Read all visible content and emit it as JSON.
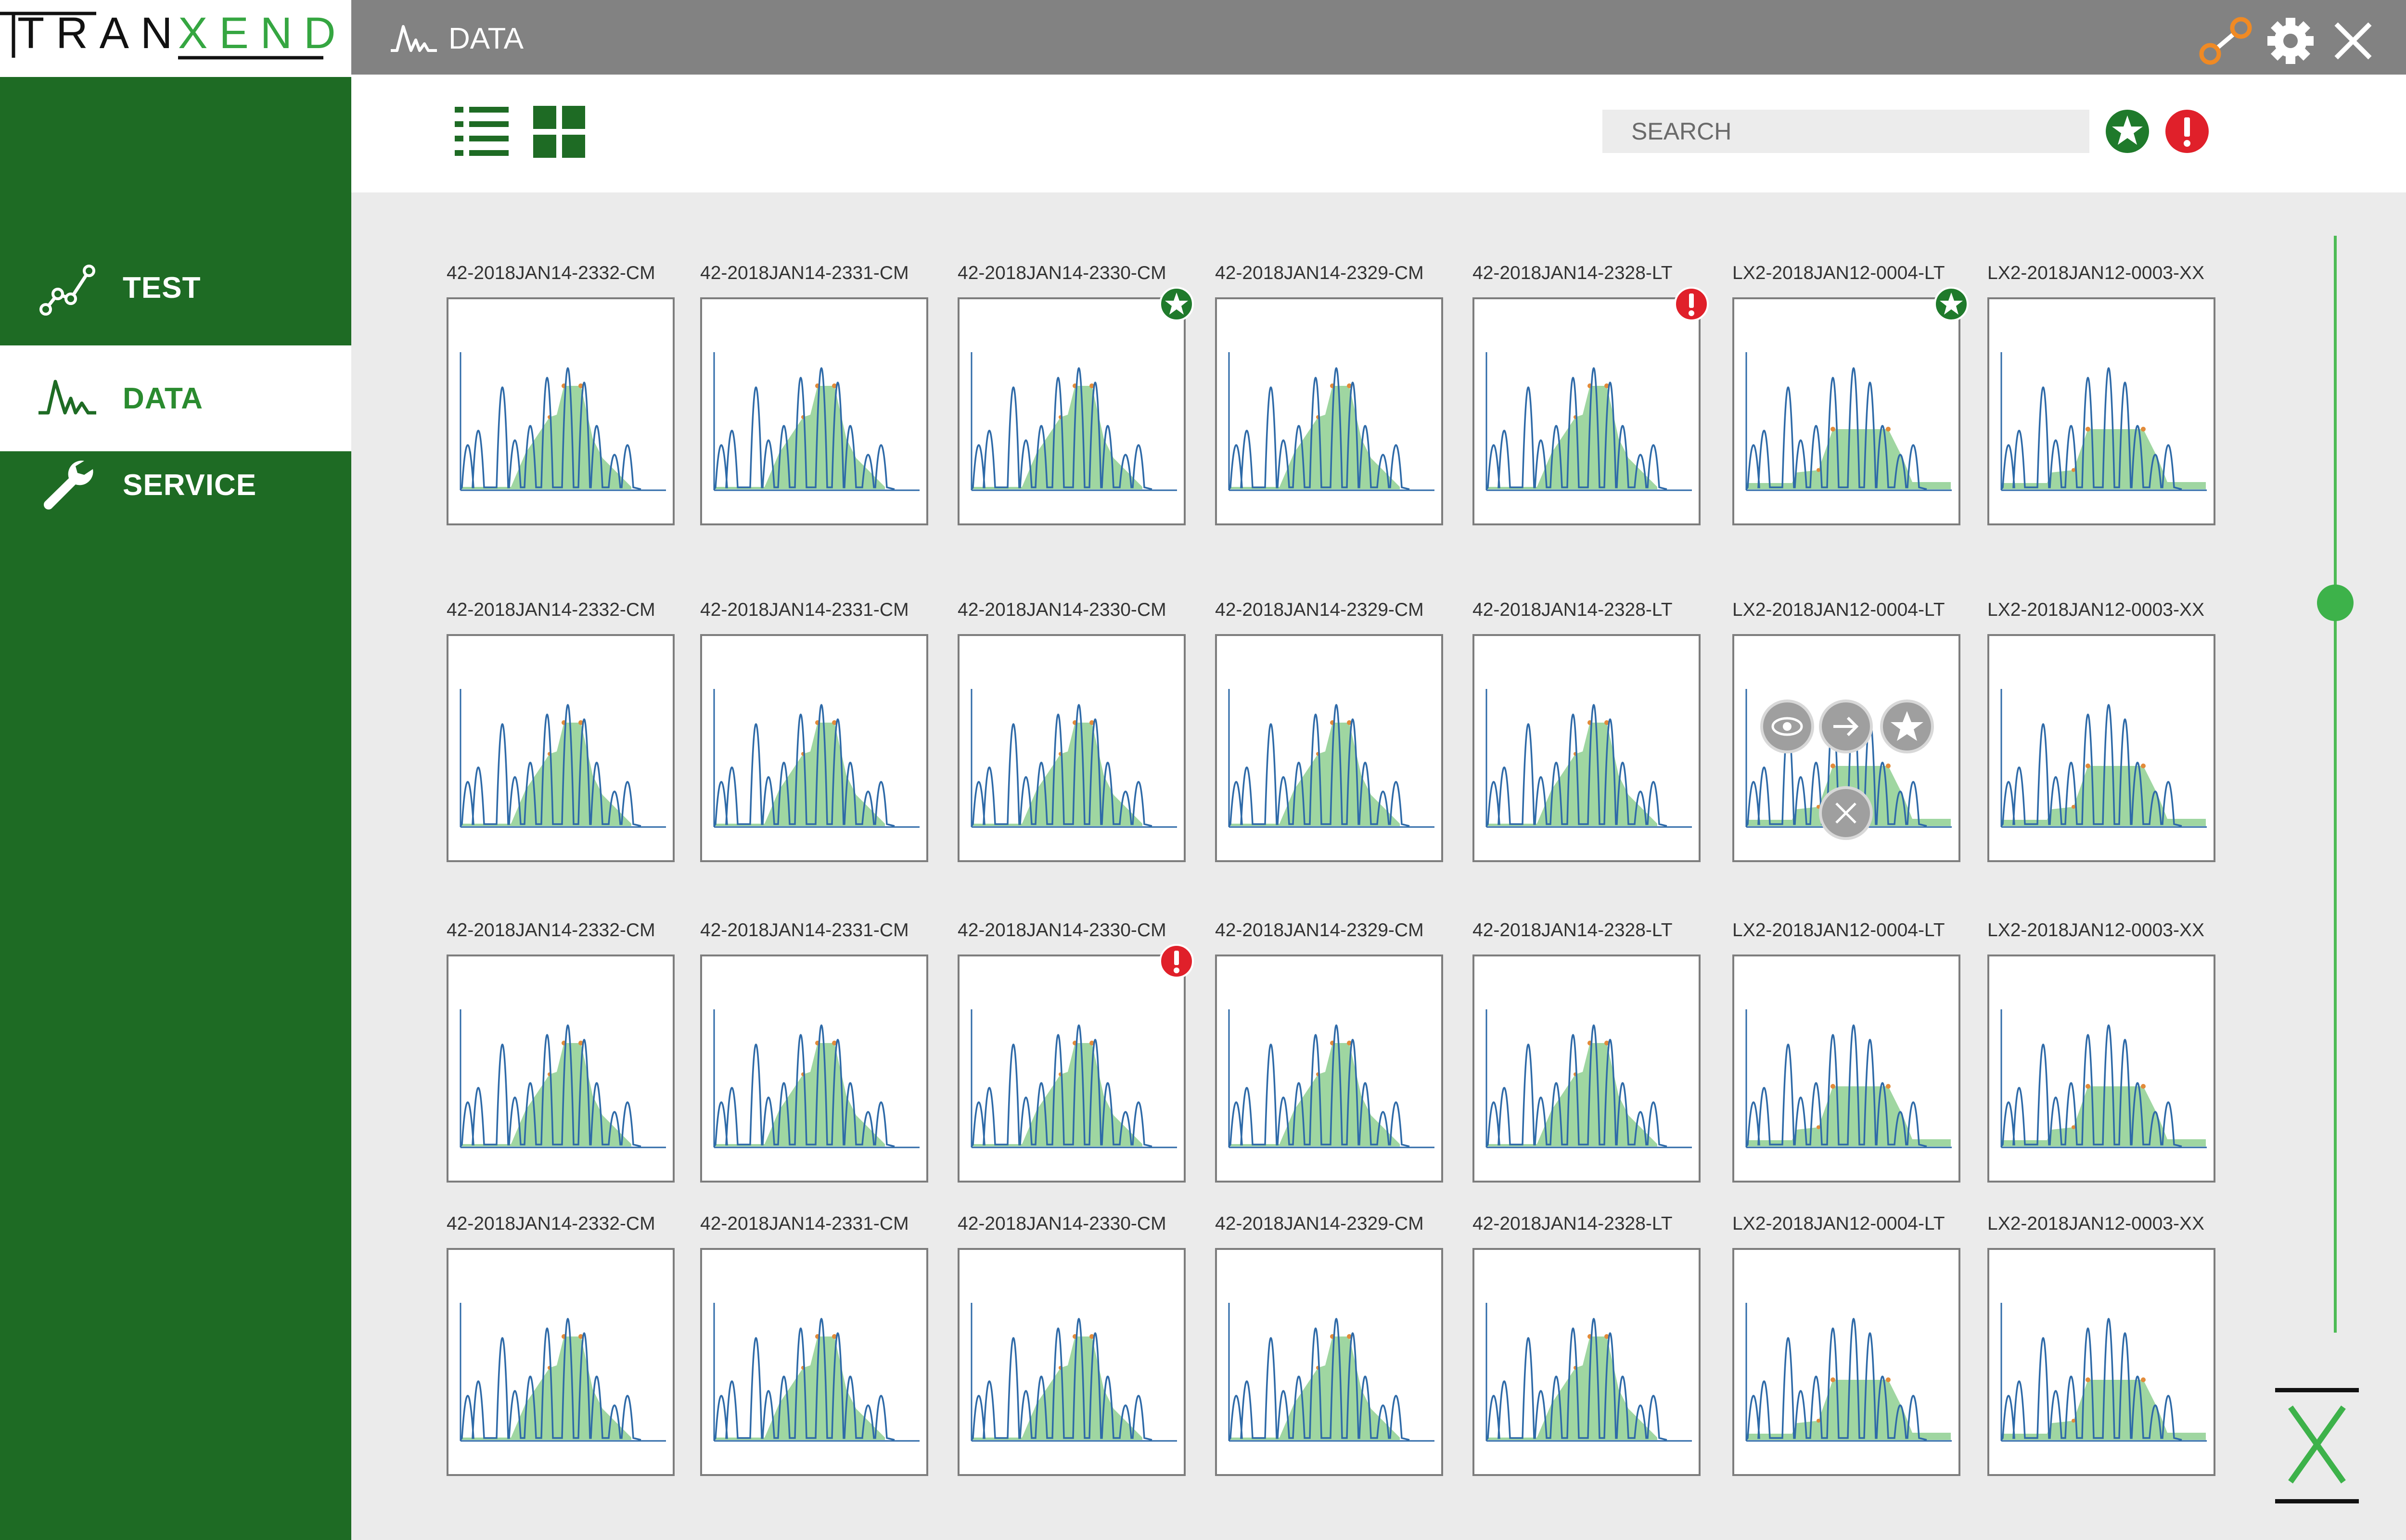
{
  "brand": {
    "left": "TRAN",
    "right": "XEND"
  },
  "topbar": {
    "title": "DATA",
    "icons": [
      "connection-icon",
      "gear-icon",
      "close-icon"
    ]
  },
  "nav": {
    "items": [
      {
        "label": "TEST",
        "icon": "line-chart-icon",
        "active": false
      },
      {
        "label": "DATA",
        "icon": "peak-wave-icon",
        "active": true
      },
      {
        "label": "SERVICE",
        "icon": "wrench-icon",
        "active": false
      }
    ]
  },
  "toolbar": {
    "view_modes": [
      "list-view-icon",
      "grid-view-icon"
    ],
    "filters": [
      "favorite-filter-icon",
      "alert-filter-icon"
    ]
  },
  "search": {
    "placeholder": "SEARCH"
  },
  "grid": {
    "columns": [
      "42-2018JAN14-2332-CM",
      "42-2018JAN14-2331-CM",
      "42-2018JAN14-2330-CM",
      "42-2018JAN14-2329-CM",
      "42-2018JAN14-2328-LT",
      "LX2-2018JAN12-0004-LT",
      "LX2-2018JAN12-0003-XX"
    ],
    "rows": 4,
    "badges": [
      {
        "row": 0,
        "col": 2,
        "type": "favorite"
      },
      {
        "row": 0,
        "col": 4,
        "type": "alert"
      },
      {
        "row": 0,
        "col": 5,
        "type": "favorite"
      },
      {
        "row": 2,
        "col": 2,
        "type": "alert"
      }
    ],
    "hover_card": {
      "row": 1,
      "col": 5,
      "actions": [
        "view-icon",
        "open-arrow-icon",
        "favorite-action-icon",
        "delete-action-icon"
      ]
    }
  },
  "scroll": {
    "position": 0.32
  },
  "colors": {
    "sidebar": "#1e6b24",
    "accent": "#3db24a",
    "fill": "#9fd6a1",
    "line": "#2e6aa8",
    "alert": "#e0202a",
    "favorite": "#1f7a2b"
  }
}
